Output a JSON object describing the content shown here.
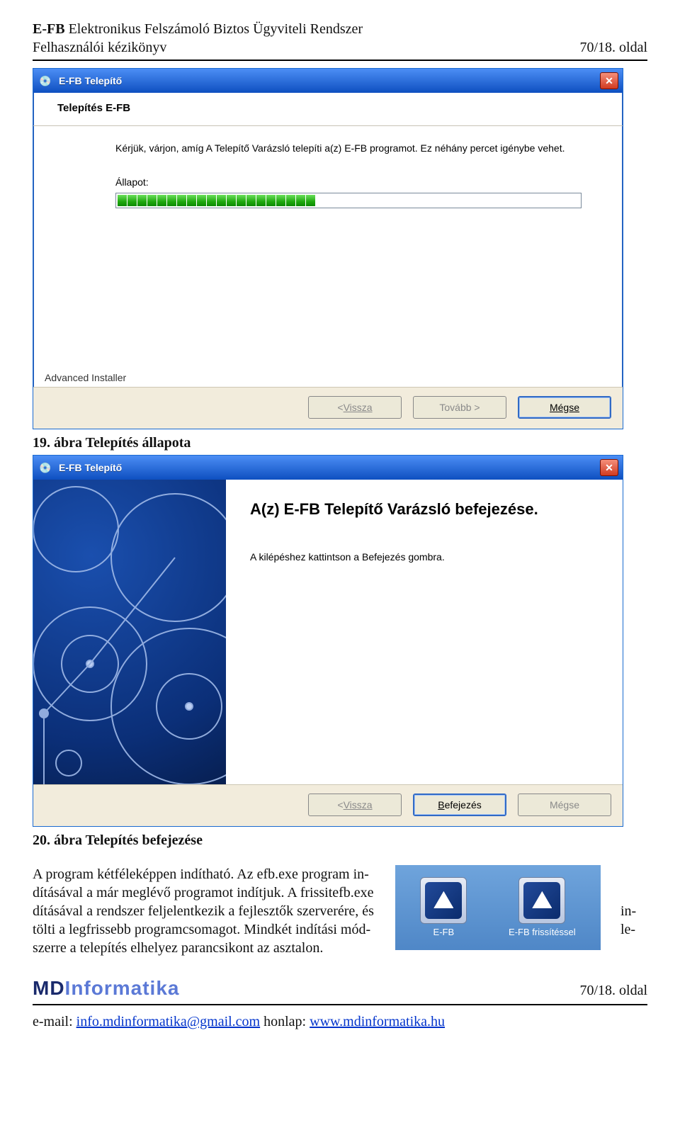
{
  "doc": {
    "title_bold": "E-FB",
    "title_rest": " Elektronikus Felszámoló Biztos Ügyviteli Rendszer",
    "subtitle": "Felhasználói kézikönyv",
    "page_label_top": "70/18. oldal",
    "page_label_bottom": "70/18. oldal"
  },
  "win1": {
    "title": "E-FB Telepítő",
    "subtitle": "Telepítés E-FB",
    "message": "Kérjük, várjon, amíg A Telepítő Varázsló telepíti a(z) E-FB programot. Ez néhány percet igénybe vehet.",
    "status_label": "Állapot:",
    "adv_installer": "Advanced Installer",
    "back": "Vissza",
    "next": "Tovább >",
    "cancel": "Mégse",
    "progress_percent": 48
  },
  "caption1": "19. ábra Telepítés állapota",
  "win2": {
    "title": "E-FB Telepítő",
    "heading": "A(z) E-FB Telepítő Varázsló befejezése.",
    "message": "A kilépéshez kattintson a Befejezés gombra.",
    "back": "Vissza",
    "finish": "Befejezés",
    "cancel": "Mégse"
  },
  "caption2": "20. ábra Telepítés befejezése",
  "paragraph": {
    "s1": "A program kétféleképpen indítható. Az efb.exe program in-",
    "s2": "dításával a már meglévő programot indítjuk. A frissitefb.exe",
    "s3": "dításával a rendszer feljelentkezik a fejlesztők szerverére, és",
    "s4": "tölti a legfrissebb programcsomagot. Mindkét indítási mód-",
    "s5": "szerre a telepítés elhelyez parancsikont az asztalon.",
    "right_frag1": "in-",
    "right_frag2": "le-"
  },
  "icons": {
    "i1": "E-FB",
    "i2": "E-FB frissítéssel"
  },
  "footer": {
    "logo_md": "MD",
    "logo_rest": "Informatika",
    "email_label": "e-mail: ",
    "email": "info.mdinformatika@gmail.com",
    "site_label": " honlap: ",
    "site": "www.mdinformatika.hu"
  }
}
